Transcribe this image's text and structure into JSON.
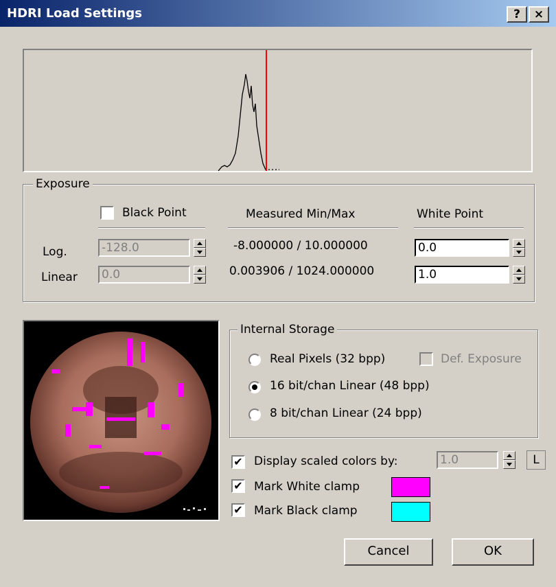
{
  "window": {
    "title": "HDRI Load Settings",
    "help_button": "?",
    "close_button": "×"
  },
  "histogram": {
    "marker_color": "#ff0000"
  },
  "exposure": {
    "legend": "Exposure",
    "black_point_label": "Black Point",
    "black_point_checked": false,
    "measured_header": "Measured Min/Max",
    "white_point_header": "White Point",
    "log_label": "Log.",
    "linear_label": "Linear",
    "black_log": "-128.0",
    "black_linear": "0.0",
    "measured_log": "-8.000000 / 10.000000",
    "measured_linear": "0.003906 / 1024.000000",
    "white_log": "0.0",
    "white_linear": "1.0"
  },
  "storage": {
    "legend": "Internal Storage",
    "options": [
      {
        "label": "Real Pixels (32 bpp)",
        "selected": false
      },
      {
        "label": "16 bit/chan Linear (48 bpp)",
        "selected": true
      },
      {
        "label": "8 bit/chan Linear (24 bpp)",
        "selected": false
      }
    ],
    "def_exposure_label": "Def. Exposure"
  },
  "display": {
    "scaled_label": "Display scaled colors by:",
    "scaled_checked": true,
    "scaled_value": "1.0",
    "l_button": "L",
    "mark_white_label": "Mark White clamp",
    "mark_white_checked": true,
    "mark_white_color": "#ff00ff",
    "mark_black_label": "Mark Black clamp",
    "mark_black_checked": true,
    "mark_black_color": "#00ffff"
  },
  "buttons": {
    "cancel": "Cancel",
    "ok": "OK"
  },
  "check_glyph": "✔"
}
